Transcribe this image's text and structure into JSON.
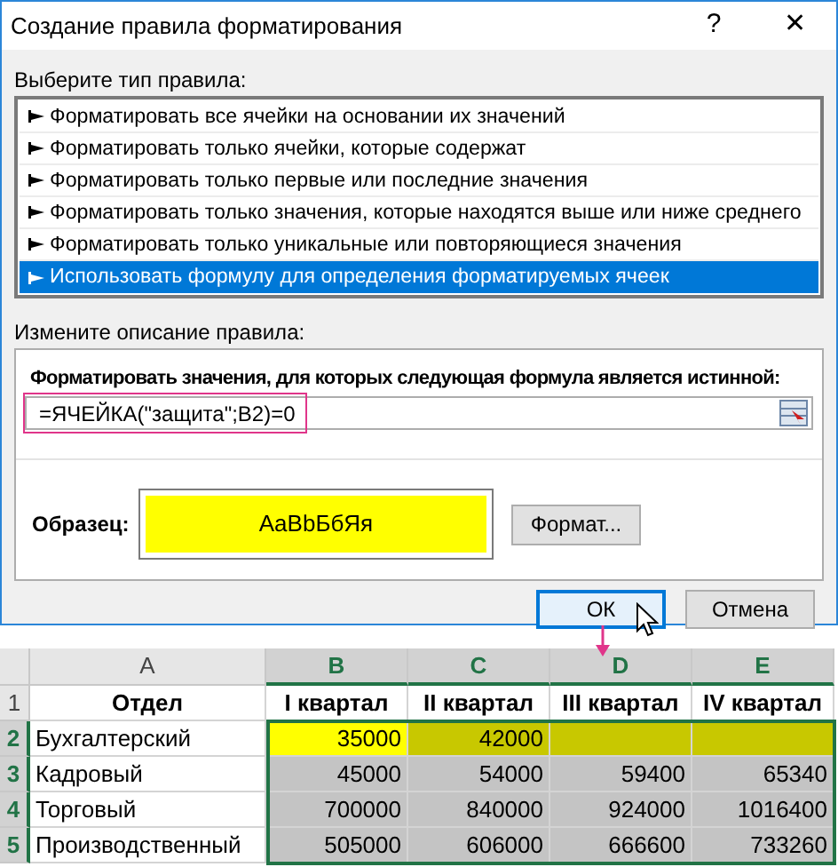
{
  "window": {
    "title": "Создание правила форматирования",
    "help": "?",
    "close": "✕"
  },
  "rule_type": {
    "label": "Выберите тип правила:",
    "items": [
      {
        "label": "Форматировать все ячейки на основании их значений",
        "selected": false
      },
      {
        "label": "Форматировать только ячейки, которые содержат",
        "selected": false
      },
      {
        "label": "Форматировать только первые или последние значения",
        "selected": false
      },
      {
        "label": "Форматировать только значения, которые находятся выше или ниже среднего",
        "selected": false
      },
      {
        "label": "Форматировать только уникальные или повторяющиеся значения",
        "selected": false
      },
      {
        "label": "Использовать формулу для определения форматируемых ячеек",
        "selected": true
      }
    ]
  },
  "rule_description": {
    "label": "Измените описание правила:",
    "formula_label": "Форматировать значения, для которых следующая формула является истинной:",
    "formula": "=ЯЧЕЙКА(\"защита\";B2)=0",
    "sample_label": "Образец:",
    "sample_text": "AaBbБбЯя",
    "format_button": "Формат..."
  },
  "buttons": [
    {
      "label": "ОК",
      "default": true
    },
    {
      "label": "Отмена",
      "default": false
    }
  ],
  "sheet": {
    "columns": [
      {
        "label": "A",
        "selected": false
      },
      {
        "label": "B",
        "selected": true
      },
      {
        "label": "C",
        "selected": true
      },
      {
        "label": "D",
        "selected": true
      },
      {
        "label": "E",
        "selected": true
      }
    ],
    "rows": [
      {
        "number": "1",
        "selected": false,
        "cells": [
          {
            "text": "Отдел",
            "kind": "header"
          },
          {
            "text": "I квартал",
            "kind": "header"
          },
          {
            "text": "II квартал",
            "kind": "header"
          },
          {
            "text": "III квартал",
            "kind": "header"
          },
          {
            "text": "IV квартал",
            "kind": "header"
          }
        ]
      },
      {
        "number": "2",
        "selected": true,
        "cells": [
          {
            "text": "Бухгалтерский",
            "kind": "label"
          },
          {
            "text": "35000",
            "kind": "number",
            "color": "#ffff00"
          },
          {
            "text": "42000",
            "kind": "number",
            "color": "#c8c800"
          },
          {
            "text": "",
            "kind": "number",
            "color": "#c8c800"
          },
          {
            "text": "",
            "kind": "number",
            "color": "#c8c800"
          }
        ]
      },
      {
        "number": "3",
        "selected": true,
        "cells": [
          {
            "text": "Кадровый",
            "kind": "label"
          },
          {
            "text": "45000",
            "kind": "number",
            "color": "#c4c4c4"
          },
          {
            "text": "54000",
            "kind": "number",
            "color": "#c4c4c4"
          },
          {
            "text": "59400",
            "kind": "number",
            "color": "#c4c4c4"
          },
          {
            "text": "65340",
            "kind": "number",
            "color": "#c4c4c4"
          }
        ]
      },
      {
        "number": "4",
        "selected": true,
        "cells": [
          {
            "text": "Торговый",
            "kind": "label"
          },
          {
            "text": "700000",
            "kind": "number",
            "color": "#c4c4c4"
          },
          {
            "text": "840000",
            "kind": "number",
            "color": "#c4c4c4"
          },
          {
            "text": "924000",
            "kind": "number",
            "color": "#c4c4c4"
          },
          {
            "text": "1016400",
            "kind": "number",
            "color": "#c4c4c4"
          }
        ]
      },
      {
        "number": "5",
        "selected": true,
        "cells": [
          {
            "text": "Производственный",
            "kind": "label"
          },
          {
            "text": "505000",
            "kind": "number",
            "color": "#c4c4c4"
          },
          {
            "text": "606000",
            "kind": "number",
            "color": "#c4c4c4"
          },
          {
            "text": "666600",
            "kind": "number",
            "color": "#c4c4c4"
          },
          {
            "text": "733260",
            "kind": "number",
            "color": "#c4c4c4"
          }
        ]
      }
    ]
  }
}
